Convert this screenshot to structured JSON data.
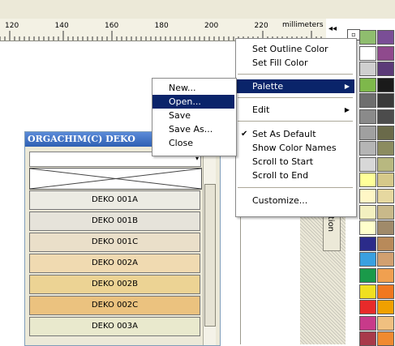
{
  "ruler": {
    "ticks": [
      "120",
      "140",
      "160",
      "180",
      "200",
      "220"
    ],
    "unit": "millimeters",
    "scroll_glyph": "◂◂"
  },
  "docker_tab": {
    "label": "mation"
  },
  "palette_button": {
    "glyph": "▫"
  },
  "palette_window": {
    "title": "ORGACHIM(C) DEKO",
    "combo_arrow": "▾",
    "rows": [
      {
        "label": "DEKO 001A",
        "color": "#ecebe3"
      },
      {
        "label": "DEKO 001B",
        "color": "#e6e3da"
      },
      {
        "label": "DEKO 001C",
        "color": "#eadfc9"
      },
      {
        "label": "DEKO 002A",
        "color": "#f0dab1"
      },
      {
        "label": "DEKO 002B",
        "color": "#ecd394"
      },
      {
        "label": "DEKO 002C",
        "color": "#ebc27f"
      },
      {
        "label": "DEKO 003A",
        "color": "#e9e9cd"
      }
    ]
  },
  "context_menu": {
    "items": [
      {
        "label": "Set Outline Color",
        "active": false,
        "submenu": false,
        "checked": false
      },
      {
        "label": "Set Fill Color",
        "active": false,
        "submenu": false,
        "checked": false
      },
      {
        "label": "Palette",
        "active": true,
        "submenu": true,
        "checked": false
      },
      {
        "label": "Edit",
        "active": false,
        "submenu": true,
        "checked": false
      },
      {
        "label": "Set As Default",
        "active": false,
        "submenu": false,
        "checked": true
      },
      {
        "label": "Show Color Names",
        "active": false,
        "submenu": false,
        "checked": false
      },
      {
        "label": "Scroll to Start",
        "active": false,
        "submenu": false,
        "checked": false
      },
      {
        "label": "Scroll to End",
        "active": false,
        "submenu": false,
        "checked": false
      },
      {
        "label": "Customize...",
        "active": false,
        "submenu": false,
        "checked": false
      }
    ],
    "check_glyph": "✔",
    "submenu_glyph": "▶"
  },
  "palette_submenu": {
    "items": [
      {
        "label": "New...",
        "active": false
      },
      {
        "label": "Open...",
        "active": true
      },
      {
        "label": "Save",
        "active": false
      },
      {
        "label": "Save As...",
        "active": false
      },
      {
        "label": "Close",
        "active": false
      }
    ]
  },
  "swatches": {
    "colors": [
      [
        "#8fbd6e",
        "#7a4e96"
      ],
      [
        "#ffffff",
        "#8f4a8d"
      ],
      [
        "#cfcfcf",
        "#5b3a78"
      ],
      [
        "#7eb84b",
        "#1a1a1a"
      ],
      [
        "#6e6e6e",
        "#3a3a3a"
      ],
      [
        "#8a8a8a",
        "#4c4c4c"
      ],
      [
        "#a0a0a0",
        "#6a6a4a"
      ],
      [
        "#b5b5b5",
        "#8c8c60"
      ],
      [
        "#d8d8d8",
        "#b8b880"
      ],
      [
        "#ffff99",
        "#d6c98a"
      ],
      [
        "#fff7c6",
        "#e6d8a0"
      ],
      [
        "#f3f0c0",
        "#c9b98a"
      ],
      [
        "#ffffcc",
        "#a08a6a"
      ],
      [
        "#2b2b8a",
        "#b88a5a"
      ],
      [
        "#3aa0e0",
        "#d2a070"
      ],
      [
        "#1a9a4a",
        "#f0a050"
      ],
      [
        "#f0e020",
        "#f07820"
      ],
      [
        "#e82a2a",
        "#f0a000"
      ],
      [
        "#c83a8a",
        "#f0c080"
      ],
      [
        "#a83a4a",
        "#f08a30"
      ]
    ]
  }
}
